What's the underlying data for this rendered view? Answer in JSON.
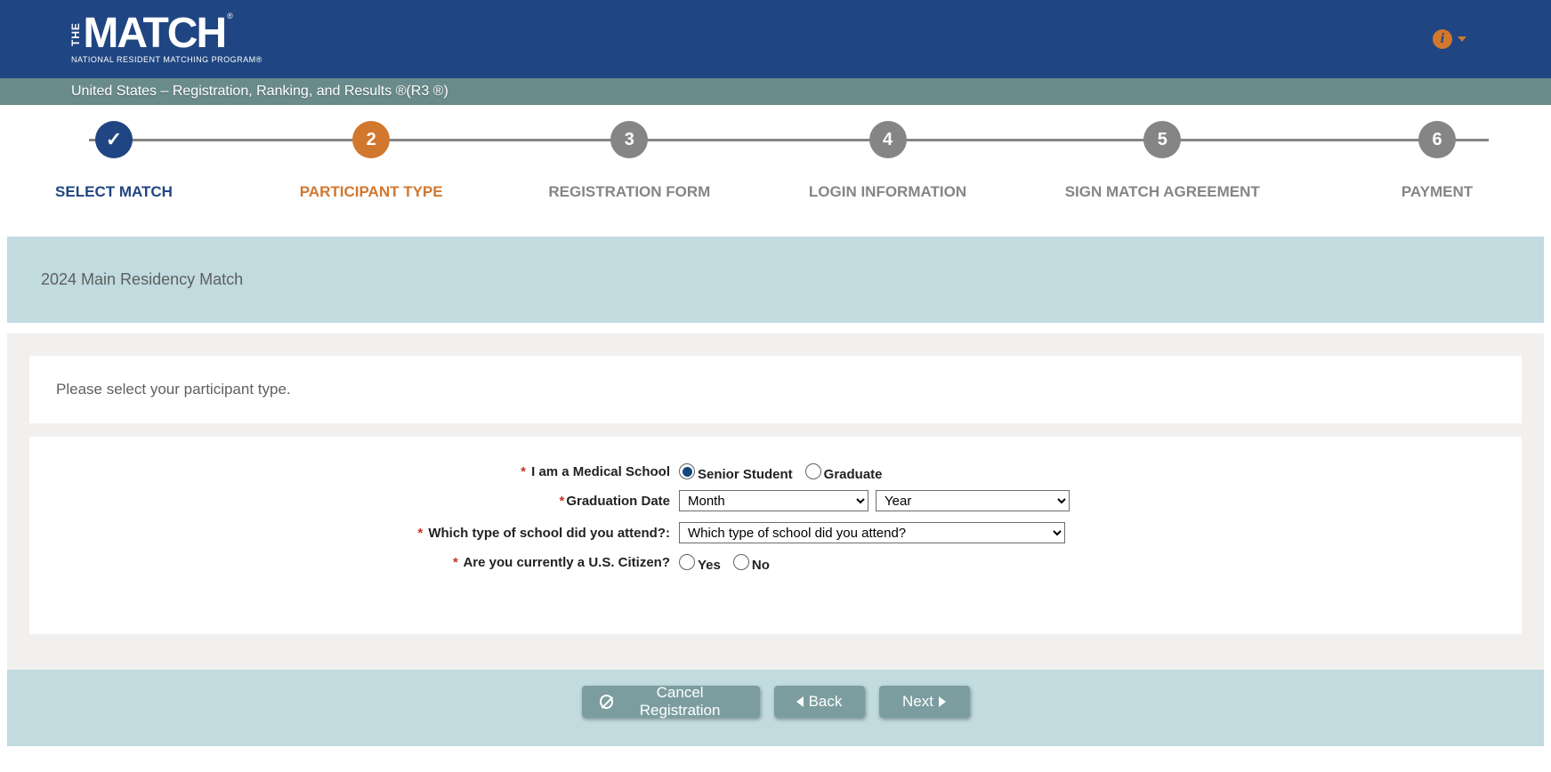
{
  "header": {
    "logo_the": "THE",
    "logo_match": "MATCH",
    "logo_reg": "®",
    "logo_sub": "NATIONAL RESIDENT MATCHING PROGRAM®",
    "info_glyph": "i"
  },
  "subheader": "United States   –  Registration, Ranking, and Results ®(R3 ®)",
  "steps": [
    {
      "num": "✓",
      "label": "SELECT MATCH",
      "state": "completed"
    },
    {
      "num": "2",
      "label": "PARTICIPANT TYPE",
      "state": "current"
    },
    {
      "num": "3",
      "label": "REGISTRATION FORM",
      "state": "upcoming"
    },
    {
      "num": "4",
      "label": "LOGIN INFORMATION",
      "state": "upcoming"
    },
    {
      "num": "5",
      "label": "SIGN MATCH AGREEMENT",
      "state": "upcoming"
    },
    {
      "num": "6",
      "label": "PAYMENT",
      "state": "upcoming"
    }
  ],
  "banner": "2024 Main Residency Match",
  "prompt": "Please select your participant type.",
  "form": {
    "medschool_label": " I am a Medical School",
    "medschool_options": {
      "senior": "Senior Student",
      "grad": "Graduate"
    },
    "graddate_label": "Graduation Date",
    "month_placeholder": "Month",
    "year_placeholder": "Year",
    "school_label": " Which type of school did you attend?:",
    "school_placeholder": "Which type of school did you attend?",
    "citizen_label": " Are you currently a U.S. Citizen?",
    "citizen_options": {
      "yes": "Yes",
      "no": "No"
    }
  },
  "buttons": {
    "cancel": "Cancel Registration",
    "back": "Back",
    "next": "Next"
  }
}
